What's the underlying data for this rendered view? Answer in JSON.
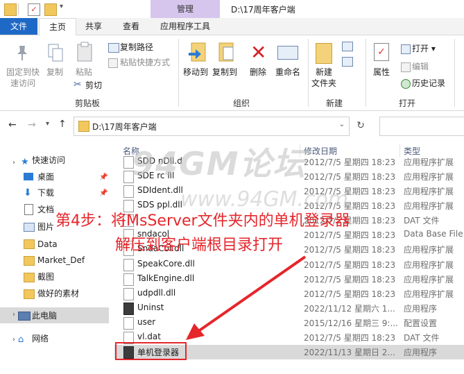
{
  "titlebar": {
    "manage_tab": "管理",
    "title": "D:\\17周年客户端"
  },
  "tabs": {
    "file": "文件",
    "home": "主页",
    "share": "共享",
    "view": "查看",
    "app_tools": "应用程序工具"
  },
  "ribbon": {
    "pin": "固定到快",
    "pin2": "速访问",
    "copy": "复制",
    "paste": "粘贴",
    "copy_path": "复制路径",
    "paste_shortcut": "粘贴快捷方式",
    "cut": "剪切",
    "clipboard_label": "剪贴板",
    "move_to": "移动到",
    "copy_to": "复制到",
    "delete": "删除",
    "rename": "重命名",
    "organize_label": "组织",
    "new_folder": "新建",
    "new_folder2": "文件夹",
    "new_label": "新建",
    "properties": "属性",
    "open": "打开",
    "edit": "编辑",
    "history": "历史记录",
    "open_label": "打开"
  },
  "address": {
    "path": "D:\\17周年客户端"
  },
  "nav": {
    "items": [
      {
        "label": "快速访问"
      },
      {
        "label": "桌面"
      },
      {
        "label": "下载"
      },
      {
        "label": "文档"
      },
      {
        "label": "图片"
      },
      {
        "label": "Data"
      },
      {
        "label": "Market_Def"
      },
      {
        "label": "截图"
      },
      {
        "label": "做好的素材"
      },
      {
        "label": "此电脑"
      },
      {
        "label": "网络"
      }
    ]
  },
  "columns": {
    "name": "名称",
    "date": "修改日期",
    "type": "类型"
  },
  "files": [
    {
      "name": "SDD nDll.d",
      "date": "2012/7/5 星期四 18:23",
      "type": "应用程序扩展"
    },
    {
      "name": "SDE rc lll",
      "date": "2012/7/5 星期四 18:23",
      "type": "应用程序扩展"
    },
    {
      "name": "SDIdent.dll",
      "date": "2012/7/5 星期四 18:23",
      "type": "应用程序扩展"
    },
    {
      "name": "SDS ppl.dll",
      "date": "2012/7/5 星期四 18:23",
      "type": "应用程序扩展"
    },
    {
      "name": "",
      "date": "2012/7/5 星期四 18:23",
      "type": "DAT 文件"
    },
    {
      "name": "sndacol",
      "date": "2012/7/5 星期四 18:23",
      "type": "Data Base File"
    },
    {
      "name": "SndaCol.dll",
      "date": "2012/7/5 星期四 18:23",
      "type": "应用程序扩展"
    },
    {
      "name": "SpeakCore.dll",
      "date": "2012/7/5 星期四 18:23",
      "type": "应用程序扩展"
    },
    {
      "name": "TalkEngine.dll",
      "date": "2012/7/5 星期四 18:23",
      "type": "应用程序扩展"
    },
    {
      "name": "udpdll.dll",
      "date": "2012/7/5 星期四 18:23",
      "type": "应用程序扩展"
    },
    {
      "name": "Uninst",
      "date": "2022/11/12 星期六 1...",
      "type": "应用程序"
    },
    {
      "name": "user",
      "date": "2015/12/16 星期三 9:...",
      "type": "配置设置"
    },
    {
      "name": "vl.dat",
      "date": "2012/7/5 星期四 18:23",
      "type": "DAT 文件"
    },
    {
      "name": "单机登录器",
      "date": "2022/11/13 星期日 2...",
      "type": "应用程序"
    }
  ],
  "overlay": {
    "watermark": "94GM论坛",
    "watermark2": "www.94GM.com",
    "note_line1": "第4步：将MsServer文件夹内的单机登录器",
    "note_line2": "解压到客户端根目录打开",
    "accent": "#e5262b"
  }
}
